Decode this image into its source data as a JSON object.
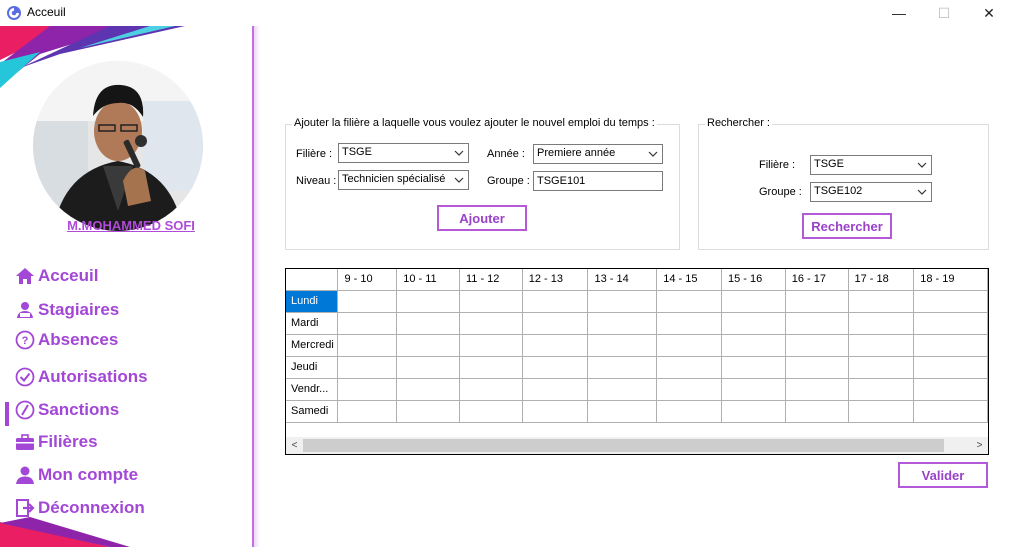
{
  "window": {
    "title": "Acceuil",
    "controls": {
      "minimize": "—",
      "maximize": "☐",
      "close": "✕"
    }
  },
  "sidebar": {
    "profile_name": "M.MOHAMMED SOFI",
    "active_item": "Filières",
    "items": [
      {
        "label": "Acceuil",
        "icon": "home-icon"
      },
      {
        "label": "Stagiaires",
        "icon": "students-icon"
      },
      {
        "label": "Absences",
        "icon": "question-circle-icon"
      },
      {
        "label": "Autorisations",
        "icon": "check-circle-icon"
      },
      {
        "label": "Sanctions",
        "icon": "slash-circle-icon"
      },
      {
        "label": "Filières",
        "icon": "briefcase-icon"
      },
      {
        "label": "Mon compte",
        "icon": "user-icon"
      },
      {
        "label": "Déconnexion",
        "icon": "logout-icon"
      }
    ],
    "accent_color": "#a347d6"
  },
  "add_form": {
    "title": "Ajouter la filière a laquelle vous voulez ajouter le nouvel emploi du temps :",
    "filiere_label": "Filière :",
    "filiere_value": "TSGE",
    "niveau_label": "Niveau :",
    "niveau_value": "Technicien spécialisé",
    "annee_label": "Année :",
    "annee_value": "Premiere année",
    "groupe_label": "Groupe :",
    "groupe_value": "TSGE101",
    "button": "Ajouter"
  },
  "search_form": {
    "title": "Rechercher :",
    "filiere_label": "Filière :",
    "filiere_value": "TSGE",
    "groupe_label": "Groupe :",
    "groupe_value": "TSGE102",
    "button": "Rechercher"
  },
  "schedule": {
    "columns": [
      "9 - 10",
      "10 - 11",
      "11 - 12",
      "12 - 13",
      "13 - 14",
      "14 - 15",
      "15 - 16",
      "16 - 17",
      "17 - 18",
      "18 - 19"
    ],
    "rows": [
      "Lundi",
      "Mardi",
      "Mercredi",
      "Jeudi",
      "Vendr...",
      "Samedi"
    ],
    "selected_row": "Lundi",
    "scroll_left": "<",
    "scroll_right": ">"
  },
  "validate_button": "Valider"
}
